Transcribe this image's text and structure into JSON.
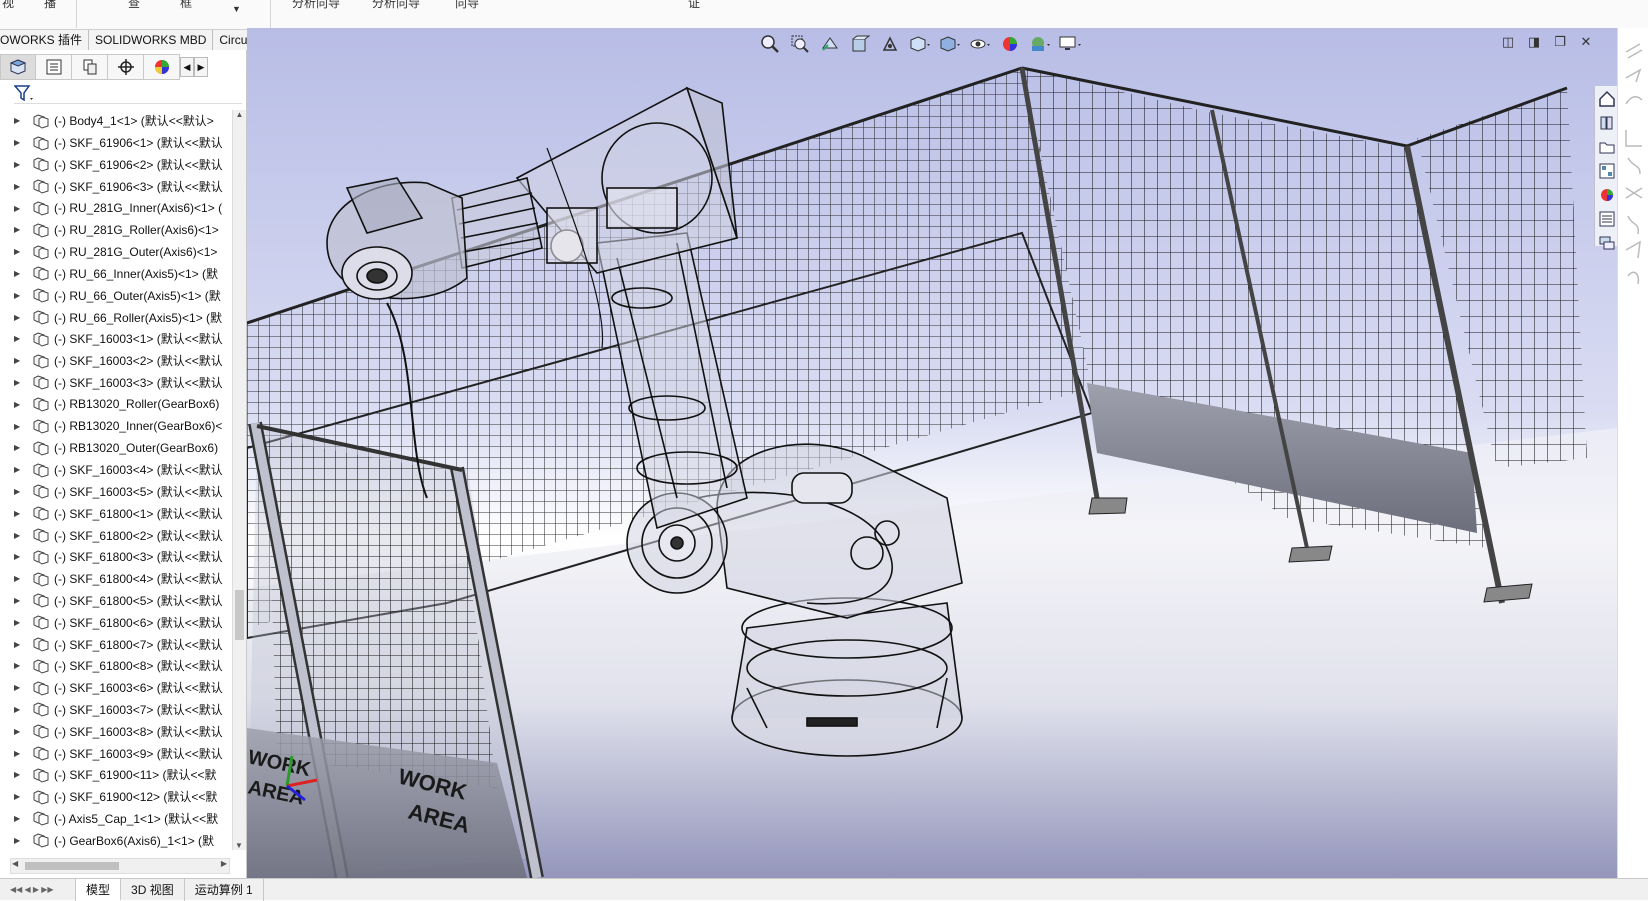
{
  "ribbon": {
    "fragments": [
      "视",
      "播",
      "查",
      "框",
      "分析向导",
      "分析向导",
      "向导",
      "证"
    ]
  },
  "command_tabs": [
    "OWORKS 插件",
    "SOLIDWORKS MBD",
    "CircuitWorks"
  ],
  "feature_tree": {
    "items": [
      "(-) Body4_1<1> (默认<<默认>",
      "(-) SKF_61906<1> (默认<<默认",
      "(-) SKF_61906<2> (默认<<默认",
      "(-) SKF_61906<3> (默认<<默认",
      "(-) RU_281G_Inner(Axis6)<1> (",
      "(-) RU_281G_Roller(Axis6)<1>",
      "(-) RU_281G_Outer(Axis6)<1>",
      "(-) RU_66_Inner(Axis5)<1> (默",
      "(-) RU_66_Outer(Axis5)<1> (默",
      "(-) RU_66_Roller(Axis5)<1> (默",
      "(-) SKF_16003<1> (默认<<默认",
      "(-) SKF_16003<2> (默认<<默认",
      "(-) SKF_16003<3> (默认<<默认",
      "(-) RB13020_Roller(GearBox6)",
      "(-) RB13020_Inner(GearBox6)<",
      "(-) RB13020_Outer(GearBox6)",
      "(-) SKF_16003<4> (默认<<默认",
      "(-) SKF_16003<5> (默认<<默认",
      "(-) SKF_61800<1> (默认<<默认",
      "(-) SKF_61800<2> (默认<<默认",
      "(-) SKF_61800<3> (默认<<默认",
      "(-) SKF_61800<4> (默认<<默认",
      "(-) SKF_61800<5> (默认<<默认",
      "(-) SKF_61800<6> (默认<<默认",
      "(-) SKF_61800<7> (默认<<默认",
      "(-) SKF_61800<8> (默认<<默认",
      "(-) SKF_16003<6> (默认<<默认",
      "(-) SKF_16003<7> (默认<<默认",
      "(-) SKF_16003<8> (默认<<默认",
      "(-) SKF_16003<9> (默认<<默认",
      "(-) SKF_61900<11> (默认<<默",
      "(-) SKF_61900<12> (默认<<默",
      "(-) Axis5_Cap_1<1> (默认<<默",
      "(-) GearBox6(Axis6)_1<1> (默"
    ]
  },
  "bottom_tabs": [
    "模型",
    "3D 视图",
    "运动算例 1"
  ],
  "viewport": {
    "signs": [
      "WORK",
      "AREA",
      "WORK",
      "AREA"
    ]
  },
  "colors": {
    "viewport_top": "#b8bde6",
    "viewport_bottom": "#9a9cc0",
    "line": "#1a1a1a"
  }
}
